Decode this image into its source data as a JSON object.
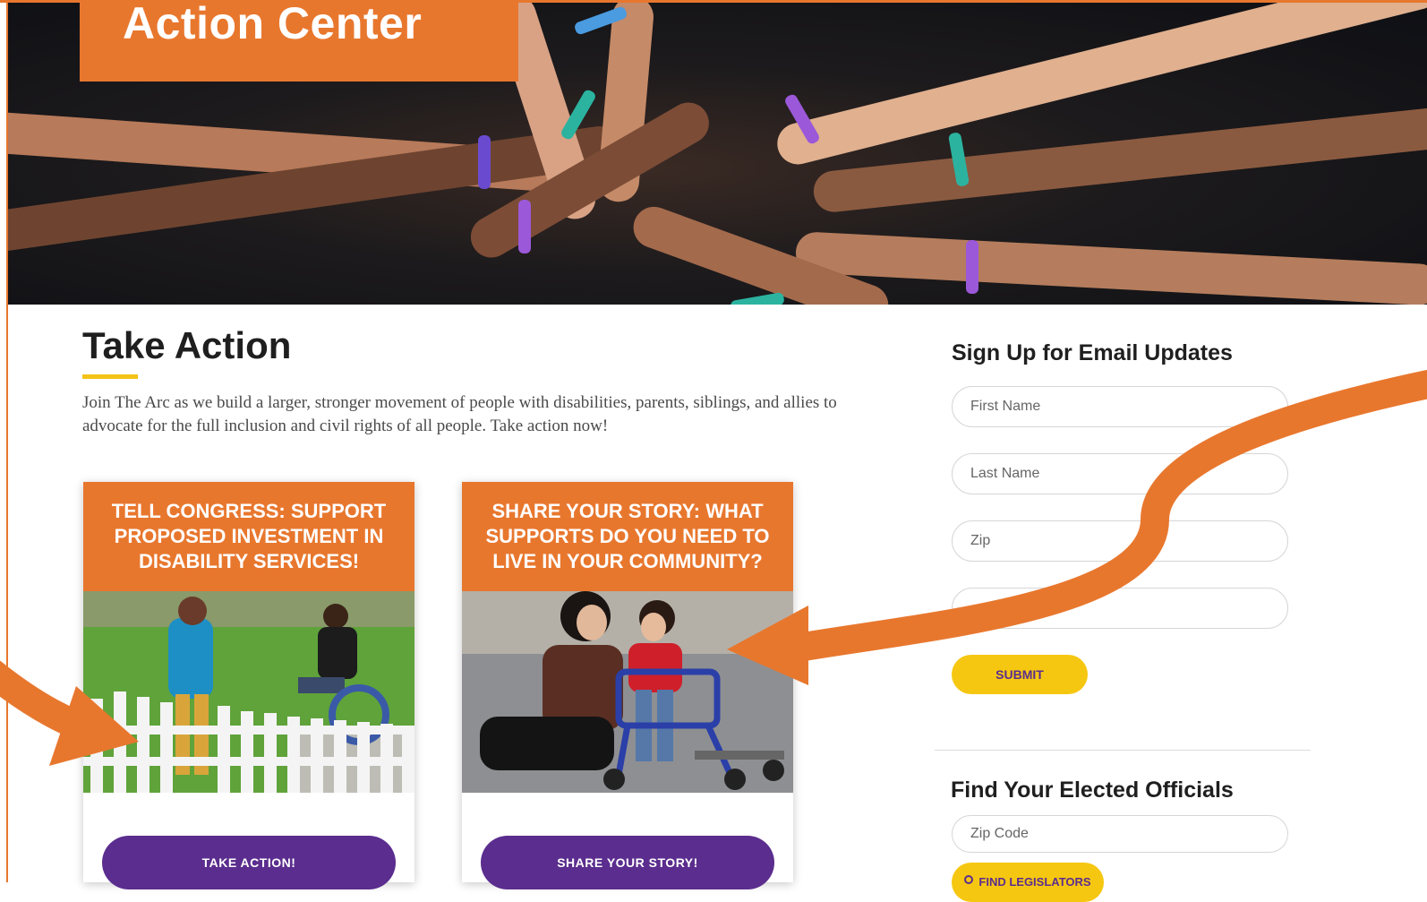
{
  "hero": {
    "title": "Action Center"
  },
  "main": {
    "heading": "Take Action",
    "intro": "Join The Arc as we build a larger, stronger movement of people with disabilities, parents, siblings, and allies to advocate for the full inclusion and civil rights of all people. Take action now!",
    "cards": [
      {
        "title": "TELL CONGRESS: SUPPORT PROPOSED INVESTMENT IN DISABILITY SERVICES!",
        "button": "TAKE ACTION!"
      },
      {
        "title": "SHARE YOUR STORY: WHAT SUPPORTS DO YOU NEED TO LIVE IN YOUR COMMUNITY?",
        "button": "SHARE YOUR STORY!"
      }
    ]
  },
  "sidebar": {
    "email": {
      "heading": "Sign Up for Email Updates",
      "first_name_placeholder": "First Name",
      "last_name_placeholder": "Last Name",
      "zip_placeholder": "Zip",
      "email_placeholder": "",
      "submit": "SUBMIT"
    },
    "officials": {
      "heading": "Find Your Elected Officials",
      "zip_placeholder": "Zip Code",
      "button": "FIND LEGISLATORS"
    }
  },
  "colors": {
    "orange": "#e8772e",
    "purple": "#5b2d8e",
    "yellow": "#f6c711"
  },
  "icons": {
    "find_button_icon": "search-icon"
  }
}
